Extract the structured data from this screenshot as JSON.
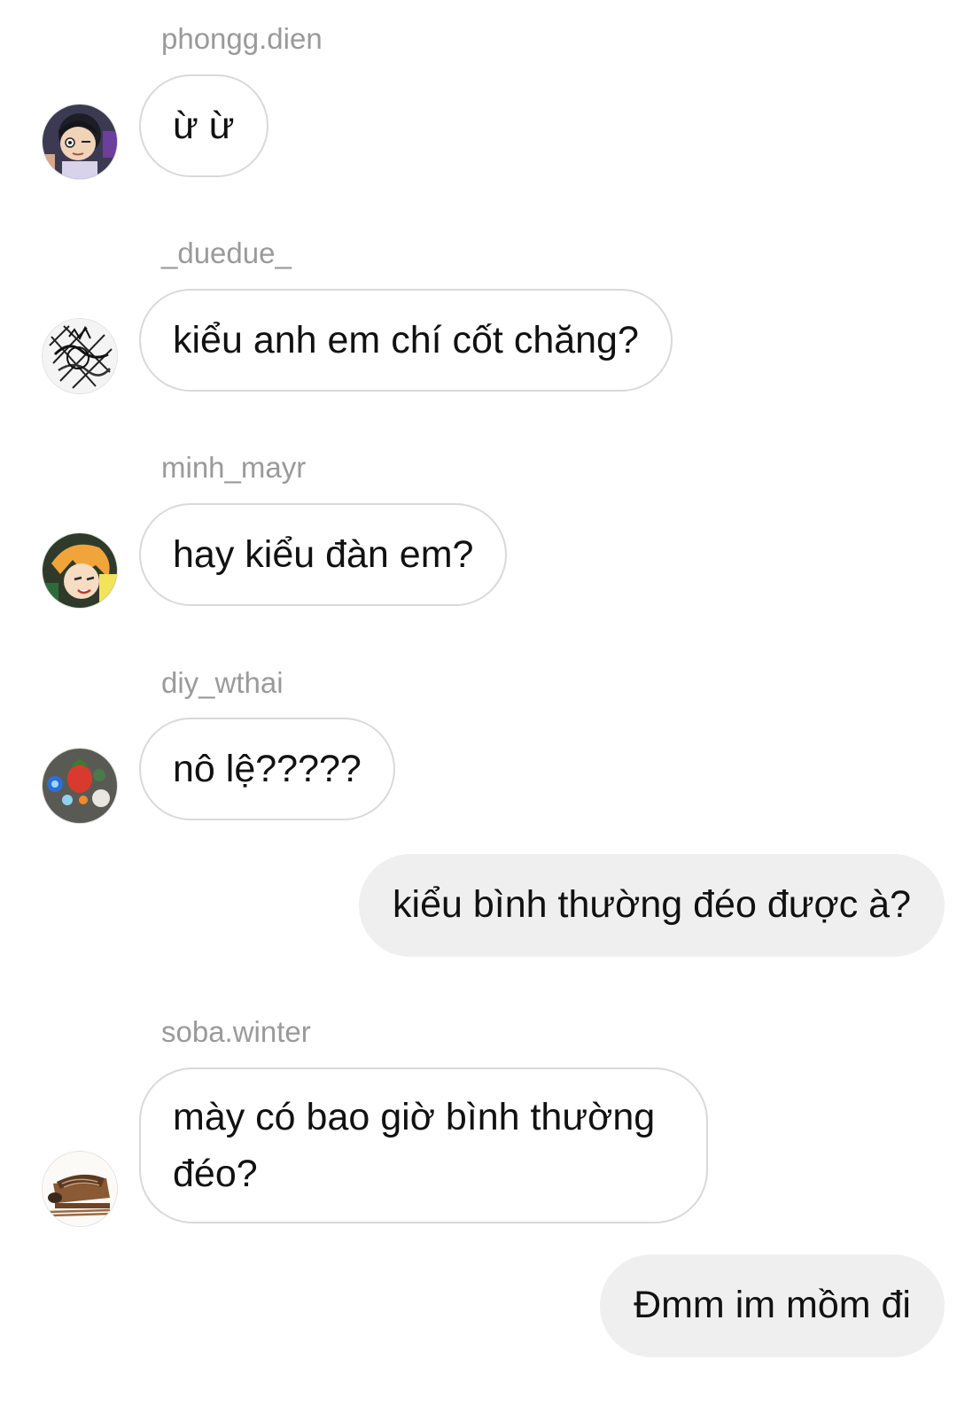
{
  "messages": [
    {
      "sender": "phongg.dien",
      "avatar": "anime-boy-wink-avatar",
      "text": "ừ ừ"
    },
    {
      "sender": "_duedue_",
      "avatar": "manga-sketch-avatar",
      "text": "kiểu anh em chí cốt chăng?"
    },
    {
      "sender": "minh_mayr",
      "avatar": "anime-blonde-avatar",
      "text": "hay kiểu đàn em?"
    },
    {
      "sender": "diy_wthai",
      "avatar": "fruit-decor-avatar",
      "text": "nô lệ?????"
    },
    {
      "sender": "me",
      "text": "kiểu bình thường đéo được à?"
    },
    {
      "sender": "soba.winter",
      "avatar": "soba-noodles-avatar",
      "text": "mày có bao giờ bình thường đéo?"
    },
    {
      "sender": "me",
      "text": "Đmm im mồm đi"
    }
  ],
  "colors": {
    "incoming_border": "#d9d9d9",
    "outgoing_bg": "#efefef",
    "username": "#9a9a9a",
    "text": "#111111"
  }
}
